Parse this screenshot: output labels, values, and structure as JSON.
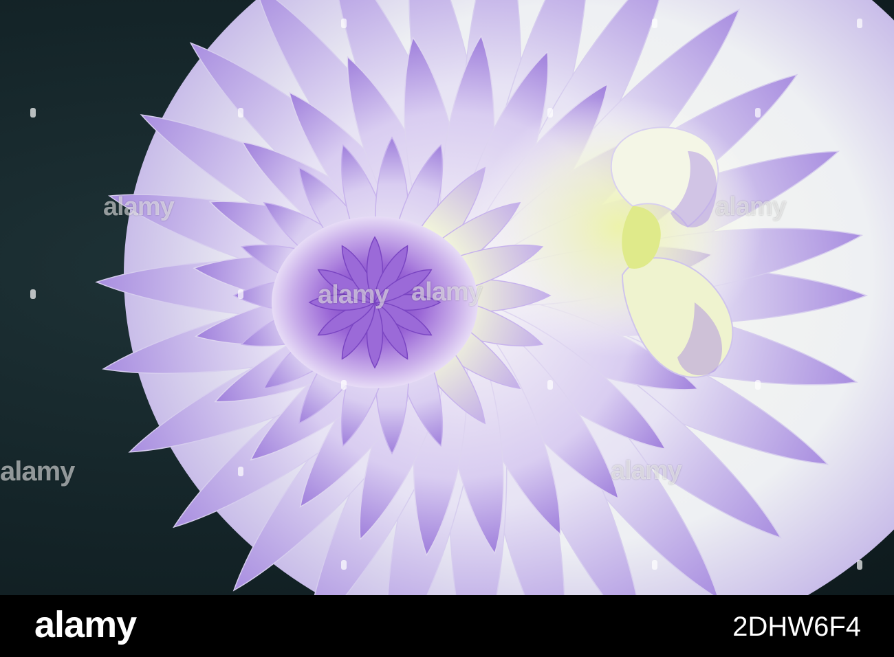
{
  "image": {
    "subject": "Close-up photograph of a white dahlia flower with lavender-tipped petals and a purple, pale-yellow center",
    "colors": {
      "background": "#142428",
      "petal_white": "#f4f6f2",
      "petal_lavender": "#b8a0e6",
      "center_purple": "#8a55cc",
      "center_yellow": "#e6ef9a"
    }
  },
  "watermark": {
    "text": "alamy",
    "icon": "alamy-logo-mark"
  },
  "footer": {
    "logo_text": "alamy",
    "image_id": "2DHW6F4"
  }
}
